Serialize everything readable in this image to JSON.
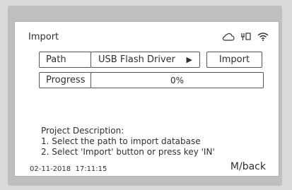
{
  "screen": {
    "title": "Import",
    "status_icons": [
      "cloud-icon",
      "usb-icon",
      "wifi-icon"
    ]
  },
  "path_row": {
    "label": "Path",
    "value": "USB Flash Driver",
    "arrow": "▶",
    "import_button": "Import"
  },
  "progress_row": {
    "label": "Progress",
    "value": "0%",
    "progress": 0
  },
  "description": {
    "heading": "Project Description:",
    "line1": "1. Select the path to import database",
    "line2": "2. Select 'Import' button or press key 'IN'"
  },
  "footer": {
    "datetime": "02-11-2018  17:11:15",
    "back": "M/back"
  }
}
